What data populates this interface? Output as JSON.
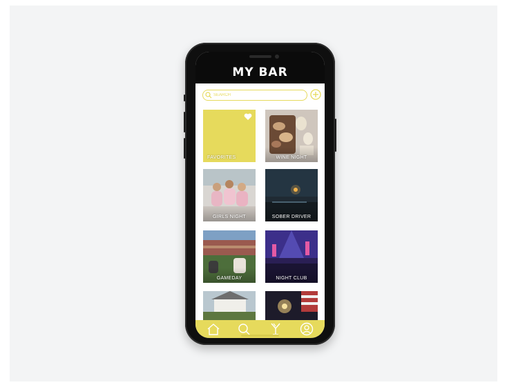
{
  "app": {
    "logo_text": "MY BAR"
  },
  "search": {
    "placeholder": "SEARCH"
  },
  "colors": {
    "accent": "#e6da5c",
    "phone": "#0f0f0f",
    "background": "#f3f4f5"
  },
  "categories": [
    {
      "label": "FAVORITES",
      "icon": "heart-icon"
    },
    {
      "label": "WINE NIGHT"
    },
    {
      "label": "GIRLS NIGHT"
    },
    {
      "label": "SOBER DRIVER"
    },
    {
      "label": "GAMEDAY"
    },
    {
      "label": "NIGHT CLUB"
    }
  ],
  "tabbar": [
    "home-icon",
    "search-icon",
    "cocktail-icon",
    "profile-icon"
  ]
}
